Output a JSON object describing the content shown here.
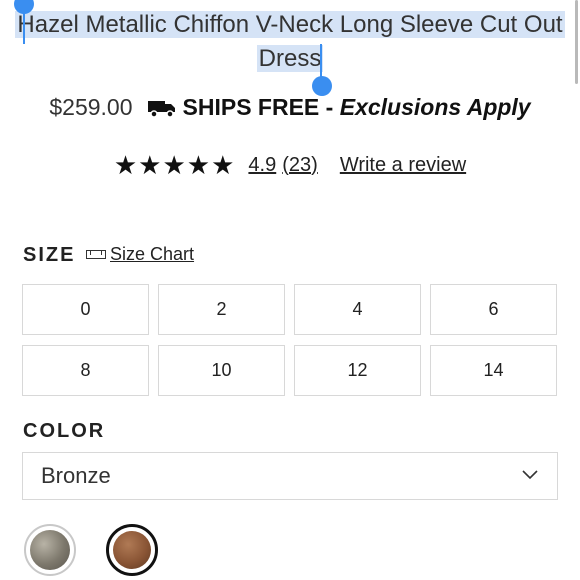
{
  "product": {
    "title": "Hazel Metallic Chiffon V-Neck Long Sleeve Cut Out Dress",
    "price": "$259.00",
    "shipping": {
      "label": "SHIPS FREE",
      "separator": " - ",
      "note": "Exclusions Apply",
      "icon": "truck-icon"
    },
    "rating": {
      "stars": 5,
      "value": "4.9",
      "count": "(23)",
      "write_review": "Write a review"
    }
  },
  "size_section": {
    "label": "SIZE",
    "size_chart": "Size Chart",
    "options": [
      "0",
      "2",
      "4",
      "6",
      "8",
      "10",
      "12",
      "14"
    ]
  },
  "color_section": {
    "label": "COLOR",
    "selected": "Bronze",
    "swatches": [
      "silver-swatch",
      "bronze-swatch"
    ]
  },
  "colors": {
    "selection": "#d5e3f6",
    "handle": "#3a8ef0",
    "border": "#d8d8d8"
  }
}
